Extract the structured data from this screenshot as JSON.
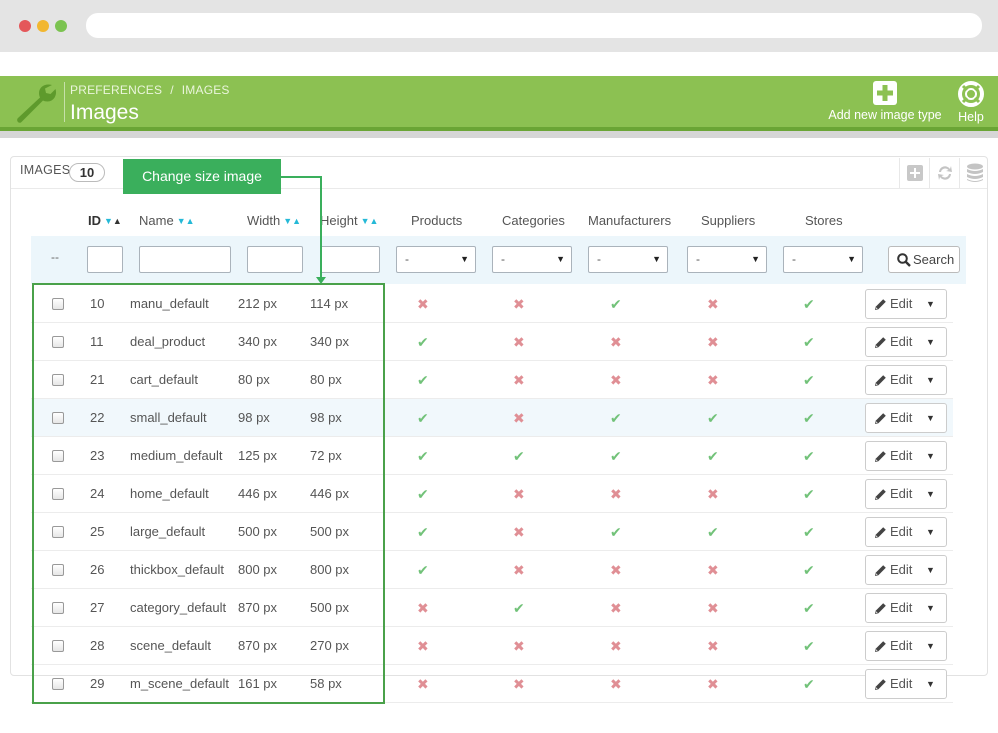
{
  "header": {
    "breadcrumb": [
      "PREFERENCES",
      "IMAGES"
    ],
    "breadcrumb_sep": "/",
    "title": "Images",
    "add_label": "Add new image type",
    "help_label": "Help",
    "bg_color": "#8cc152"
  },
  "panel": {
    "heading": "IMAGES",
    "count": "10",
    "tools": [
      "add-icon",
      "refresh-icon",
      "database-icon"
    ]
  },
  "callout": {
    "text": "Change size image",
    "color": "#3aaf5c"
  },
  "columns": {
    "id": "ID",
    "name": "Name",
    "width": "Width",
    "height": "Height",
    "products": "Products",
    "categories": "Categories",
    "manufacturers": "Manufacturers",
    "suppliers": "Suppliers",
    "stores": "Stores"
  },
  "filters": {
    "empty": "--",
    "select_value": "-",
    "search_label": "Search"
  },
  "edit_label": "Edit",
  "rows": [
    {
      "id": "10",
      "name": "manu_default",
      "width": "212 px",
      "height": "114 px",
      "products": false,
      "categories": false,
      "manufacturers": true,
      "suppliers": false,
      "stores": true
    },
    {
      "id": "11",
      "name": "deal_product",
      "width": "340 px",
      "height": "340 px",
      "products": true,
      "categories": false,
      "manufacturers": false,
      "suppliers": false,
      "stores": true
    },
    {
      "id": "21",
      "name": "cart_default",
      "width": "80 px",
      "height": "80 px",
      "products": true,
      "categories": false,
      "manufacturers": false,
      "suppliers": false,
      "stores": true
    },
    {
      "id": "22",
      "name": "small_default",
      "width": "98 px",
      "height": "98 px",
      "products": true,
      "categories": false,
      "manufacturers": true,
      "suppliers": true,
      "stores": true
    },
    {
      "id": "23",
      "name": "medium_default",
      "width": "125 px",
      "height": "72 px",
      "products": true,
      "categories": true,
      "manufacturers": true,
      "suppliers": true,
      "stores": true
    },
    {
      "id": "24",
      "name": "home_default",
      "width": "446 px",
      "height": "446 px",
      "products": true,
      "categories": false,
      "manufacturers": false,
      "suppliers": false,
      "stores": true
    },
    {
      "id": "25",
      "name": "large_default",
      "width": "500 px",
      "height": "500 px",
      "products": true,
      "categories": false,
      "manufacturers": true,
      "suppliers": true,
      "stores": true
    },
    {
      "id": "26",
      "name": "thickbox_default",
      "width": "800 px",
      "height": "800 px",
      "products": true,
      "categories": false,
      "manufacturers": false,
      "suppliers": false,
      "stores": true
    },
    {
      "id": "27",
      "name": "category_default",
      "width": "870 px",
      "height": "500 px",
      "products": false,
      "categories": true,
      "manufacturers": false,
      "suppliers": false,
      "stores": true
    },
    {
      "id": "28",
      "name": "scene_default",
      "width": "870 px",
      "height": "270 px",
      "products": false,
      "categories": false,
      "manufacturers": false,
      "suppliers": false,
      "stores": true
    },
    {
      "id": "29",
      "name": "m_scene_default",
      "width": "161 px",
      "height": "58 px",
      "products": false,
      "categories": false,
      "manufacturers": false,
      "suppliers": false,
      "stores": true
    }
  ],
  "highlighted_row_id": "22",
  "colors": {
    "yes": "#72c279",
    "no": "#e08f95",
    "highlight_box": "#4aa14a"
  }
}
